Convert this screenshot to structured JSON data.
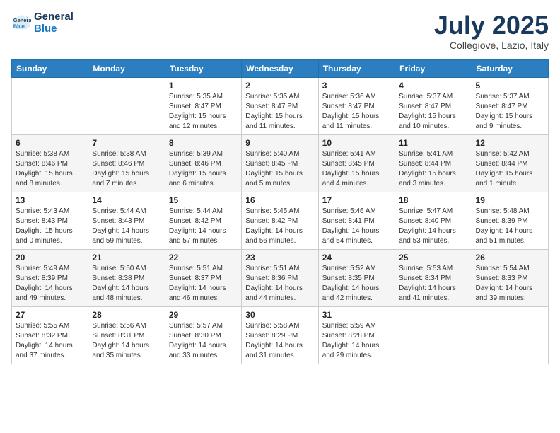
{
  "logo": {
    "line1": "General",
    "line2": "Blue"
  },
  "title": "July 2025",
  "subtitle": "Collegiove, Lazio, Italy",
  "weekdays": [
    "Sunday",
    "Monday",
    "Tuesday",
    "Wednesday",
    "Thursday",
    "Friday",
    "Saturday"
  ],
  "weeks": [
    [
      {
        "day": "",
        "info": ""
      },
      {
        "day": "",
        "info": ""
      },
      {
        "day": "1",
        "info": "Sunrise: 5:35 AM\nSunset: 8:47 PM\nDaylight: 15 hours and 12 minutes."
      },
      {
        "day": "2",
        "info": "Sunrise: 5:35 AM\nSunset: 8:47 PM\nDaylight: 15 hours and 11 minutes."
      },
      {
        "day": "3",
        "info": "Sunrise: 5:36 AM\nSunset: 8:47 PM\nDaylight: 15 hours and 11 minutes."
      },
      {
        "day": "4",
        "info": "Sunrise: 5:37 AM\nSunset: 8:47 PM\nDaylight: 15 hours and 10 minutes."
      },
      {
        "day": "5",
        "info": "Sunrise: 5:37 AM\nSunset: 8:47 PM\nDaylight: 15 hours and 9 minutes."
      }
    ],
    [
      {
        "day": "6",
        "info": "Sunrise: 5:38 AM\nSunset: 8:46 PM\nDaylight: 15 hours and 8 minutes."
      },
      {
        "day": "7",
        "info": "Sunrise: 5:38 AM\nSunset: 8:46 PM\nDaylight: 15 hours and 7 minutes."
      },
      {
        "day": "8",
        "info": "Sunrise: 5:39 AM\nSunset: 8:46 PM\nDaylight: 15 hours and 6 minutes."
      },
      {
        "day": "9",
        "info": "Sunrise: 5:40 AM\nSunset: 8:45 PM\nDaylight: 15 hours and 5 minutes."
      },
      {
        "day": "10",
        "info": "Sunrise: 5:41 AM\nSunset: 8:45 PM\nDaylight: 15 hours and 4 minutes."
      },
      {
        "day": "11",
        "info": "Sunrise: 5:41 AM\nSunset: 8:44 PM\nDaylight: 15 hours and 3 minutes."
      },
      {
        "day": "12",
        "info": "Sunrise: 5:42 AM\nSunset: 8:44 PM\nDaylight: 15 hours and 1 minute."
      }
    ],
    [
      {
        "day": "13",
        "info": "Sunrise: 5:43 AM\nSunset: 8:43 PM\nDaylight: 15 hours and 0 minutes."
      },
      {
        "day": "14",
        "info": "Sunrise: 5:44 AM\nSunset: 8:43 PM\nDaylight: 14 hours and 59 minutes."
      },
      {
        "day": "15",
        "info": "Sunrise: 5:44 AM\nSunset: 8:42 PM\nDaylight: 14 hours and 57 minutes."
      },
      {
        "day": "16",
        "info": "Sunrise: 5:45 AM\nSunset: 8:42 PM\nDaylight: 14 hours and 56 minutes."
      },
      {
        "day": "17",
        "info": "Sunrise: 5:46 AM\nSunset: 8:41 PM\nDaylight: 14 hours and 54 minutes."
      },
      {
        "day": "18",
        "info": "Sunrise: 5:47 AM\nSunset: 8:40 PM\nDaylight: 14 hours and 53 minutes."
      },
      {
        "day": "19",
        "info": "Sunrise: 5:48 AM\nSunset: 8:39 PM\nDaylight: 14 hours and 51 minutes."
      }
    ],
    [
      {
        "day": "20",
        "info": "Sunrise: 5:49 AM\nSunset: 8:39 PM\nDaylight: 14 hours and 49 minutes."
      },
      {
        "day": "21",
        "info": "Sunrise: 5:50 AM\nSunset: 8:38 PM\nDaylight: 14 hours and 48 minutes."
      },
      {
        "day": "22",
        "info": "Sunrise: 5:51 AM\nSunset: 8:37 PM\nDaylight: 14 hours and 46 minutes."
      },
      {
        "day": "23",
        "info": "Sunrise: 5:51 AM\nSunset: 8:36 PM\nDaylight: 14 hours and 44 minutes."
      },
      {
        "day": "24",
        "info": "Sunrise: 5:52 AM\nSunset: 8:35 PM\nDaylight: 14 hours and 42 minutes."
      },
      {
        "day": "25",
        "info": "Sunrise: 5:53 AM\nSunset: 8:34 PM\nDaylight: 14 hours and 41 minutes."
      },
      {
        "day": "26",
        "info": "Sunrise: 5:54 AM\nSunset: 8:33 PM\nDaylight: 14 hours and 39 minutes."
      }
    ],
    [
      {
        "day": "27",
        "info": "Sunrise: 5:55 AM\nSunset: 8:32 PM\nDaylight: 14 hours and 37 minutes."
      },
      {
        "day": "28",
        "info": "Sunrise: 5:56 AM\nSunset: 8:31 PM\nDaylight: 14 hours and 35 minutes."
      },
      {
        "day": "29",
        "info": "Sunrise: 5:57 AM\nSunset: 8:30 PM\nDaylight: 14 hours and 33 minutes."
      },
      {
        "day": "30",
        "info": "Sunrise: 5:58 AM\nSunset: 8:29 PM\nDaylight: 14 hours and 31 minutes."
      },
      {
        "day": "31",
        "info": "Sunrise: 5:59 AM\nSunset: 8:28 PM\nDaylight: 14 hours and 29 minutes."
      },
      {
        "day": "",
        "info": ""
      },
      {
        "day": "",
        "info": ""
      }
    ]
  ]
}
